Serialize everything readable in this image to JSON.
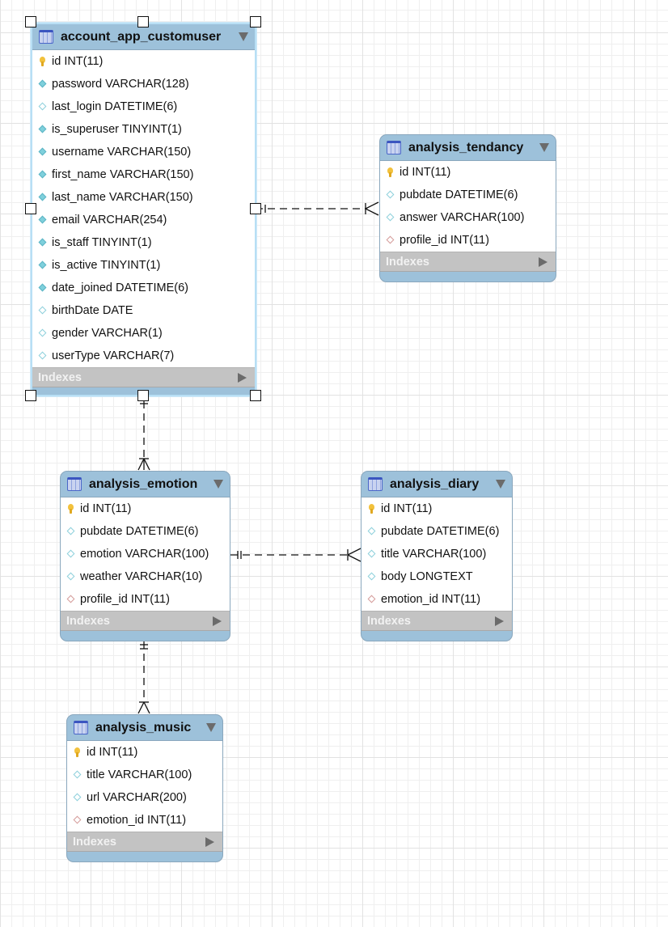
{
  "diagram": {
    "type": "EER diagram",
    "tables": [
      {
        "id": "account_app_customuser",
        "name": "account_app_customuser",
        "selected": true,
        "columns": [
          {
            "name": "id INT(11)",
            "kind": "primary-key"
          },
          {
            "name": "password VARCHAR(128)",
            "kind": "not-null"
          },
          {
            "name": "last_login DATETIME(6)",
            "kind": "nullable"
          },
          {
            "name": "is_superuser TINYINT(1)",
            "kind": "not-null"
          },
          {
            "name": "username VARCHAR(150)",
            "kind": "not-null"
          },
          {
            "name": "first_name VARCHAR(150)",
            "kind": "not-null"
          },
          {
            "name": "last_name VARCHAR(150)",
            "kind": "not-null"
          },
          {
            "name": "email VARCHAR(254)",
            "kind": "not-null"
          },
          {
            "name": "is_staff TINYINT(1)",
            "kind": "not-null"
          },
          {
            "name": "is_active TINYINT(1)",
            "kind": "not-null"
          },
          {
            "name": "date_joined DATETIME(6)",
            "kind": "not-null"
          },
          {
            "name": "birthDate DATE",
            "kind": "nullable"
          },
          {
            "name": "gender VARCHAR(1)",
            "kind": "nullable"
          },
          {
            "name": "userType VARCHAR(7)",
            "kind": "nullable"
          }
        ],
        "indexes_label": "Indexes"
      },
      {
        "id": "analysis_tendancy",
        "name": "analysis_tendancy",
        "columns": [
          {
            "name": "id INT(11)",
            "kind": "primary-key"
          },
          {
            "name": "pubdate DATETIME(6)",
            "kind": "nullable"
          },
          {
            "name": "answer VARCHAR(100)",
            "kind": "nullable"
          },
          {
            "name": "profile_id INT(11)",
            "kind": "foreign-key"
          }
        ],
        "indexes_label": "Indexes"
      },
      {
        "id": "analysis_emotion",
        "name": "analysis_emotion",
        "columns": [
          {
            "name": "id INT(11)",
            "kind": "primary-key"
          },
          {
            "name": "pubdate DATETIME(6)",
            "kind": "nullable"
          },
          {
            "name": "emotion VARCHAR(100)",
            "kind": "nullable"
          },
          {
            "name": "weather VARCHAR(10)",
            "kind": "nullable"
          },
          {
            "name": "profile_id INT(11)",
            "kind": "foreign-key"
          }
        ],
        "indexes_label": "Indexes"
      },
      {
        "id": "analysis_diary",
        "name": "analysis_diary",
        "columns": [
          {
            "name": "id INT(11)",
            "kind": "primary-key"
          },
          {
            "name": "pubdate DATETIME(6)",
            "kind": "nullable"
          },
          {
            "name": "title VARCHAR(100)",
            "kind": "nullable"
          },
          {
            "name": "body LONGTEXT",
            "kind": "nullable"
          },
          {
            "name": "emotion_id INT(11)",
            "kind": "foreign-key"
          }
        ],
        "indexes_label": "Indexes"
      },
      {
        "id": "analysis_music",
        "name": "analysis_music",
        "columns": [
          {
            "name": "id INT(11)",
            "kind": "primary-key"
          },
          {
            "name": "title VARCHAR(100)",
            "kind": "nullable"
          },
          {
            "name": "url VARCHAR(200)",
            "kind": "nullable"
          },
          {
            "name": "emotion_id INT(11)",
            "kind": "foreign-key"
          }
        ],
        "indexes_label": "Indexes"
      }
    ],
    "relationships": [
      {
        "from": "account_app_customuser",
        "to": "analysis_tendancy",
        "cardinality": "one-to-many",
        "style": "dashed"
      },
      {
        "from": "account_app_customuser",
        "to": "analysis_emotion",
        "cardinality": "one-to-many",
        "style": "dashed"
      },
      {
        "from": "analysis_emotion",
        "to": "analysis_diary",
        "cardinality": "one-to-many",
        "style": "dashed"
      },
      {
        "from": "analysis_emotion",
        "to": "analysis_music",
        "cardinality": "one-to-many",
        "style": "dashed"
      }
    ],
    "colors": {
      "header": "#9dc1da",
      "indexes_bar": "#c3c3c3",
      "primary_key": "#f2c13c",
      "column_icon": "#7fd0dc",
      "foreign_key_icon": "#d49a98",
      "selection_border": "#b8dff5"
    }
  }
}
